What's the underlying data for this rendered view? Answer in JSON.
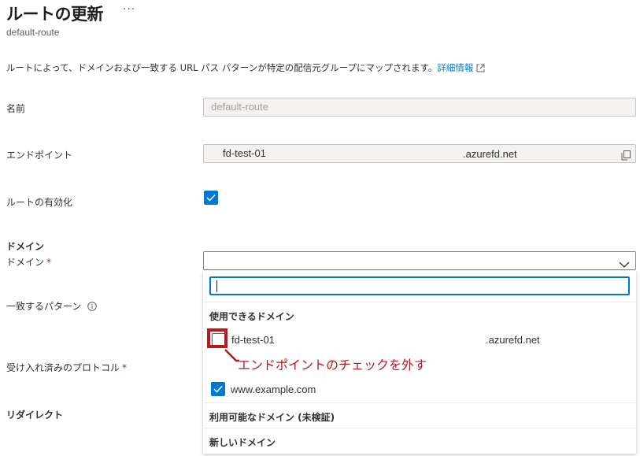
{
  "header": {
    "title": "ルートの更新",
    "more": "···",
    "subtitle": "default-route"
  },
  "description": {
    "text": "ルートによって、ドメインおよび一致する URL パス パターンが特定の配信元グループにマップされます。",
    "link": "詳細情報"
  },
  "fields": {
    "name_label": "名前",
    "name_placeholder": "default-route",
    "endpoint_label": "エンドポイント",
    "endpoint_value": "fd-test-01",
    "endpoint_suffix": ".azurefd.net",
    "enable_label": "ルートの有効化",
    "enable_checked": true,
    "domain_section": "ドメイン",
    "domain_label": "ドメイン",
    "required_mark": "*",
    "pattern_label": "一致するパターン",
    "protocol_label": "受け入れ済みのプロトコル",
    "redirect_label": "リダイレクト"
  },
  "domain_dropdown": {
    "search_value": "",
    "available_heading": "使用できるドメイン",
    "options": [
      {
        "name": "fd-test-01",
        "suffix": ".azurefd.net",
        "checked": false
      },
      {
        "name": "www.example.com",
        "suffix": "",
        "checked": true
      }
    ],
    "unverified_heading": "利用可能なドメイン (未検証)",
    "new_heading": "新しいドメイン"
  },
  "annotation": {
    "text": "エンドポイントのチェックを外す",
    "color": "#c0151c"
  },
  "colors": {
    "accent": "#0078d4",
    "required": "#a4262c"
  }
}
